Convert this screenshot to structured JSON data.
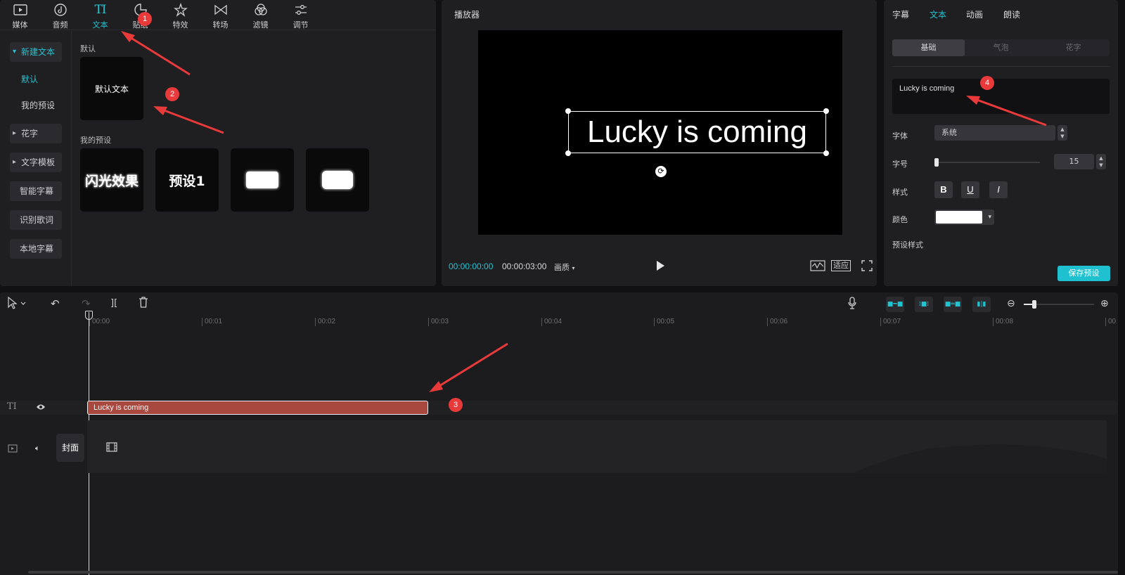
{
  "categories": [
    {
      "label": "媒体",
      "icon": "media-icon"
    },
    {
      "label": "音频",
      "icon": "audio-icon"
    },
    {
      "label": "文本",
      "icon": "text-icon"
    },
    {
      "label": "贴纸",
      "icon": "sticker-icon"
    },
    {
      "label": "特效",
      "icon": "effects-icon"
    },
    {
      "label": "转场",
      "icon": "transition-icon"
    },
    {
      "label": "滤镜",
      "icon": "filter-icon"
    },
    {
      "label": "调节",
      "icon": "adjust-icon"
    }
  ],
  "subnav": {
    "new_text": "新建文本",
    "default": "默认",
    "my_presets": "我的预设",
    "fancy_text": "花字",
    "text_template": "文字模板",
    "smart_subtitles": "智能字幕",
    "recognize_lyrics": "识别歌词",
    "local_subtitles": "本地字幕"
  },
  "library": {
    "default_section": "默认",
    "default_card": "默认文本",
    "presets_section": "我的预设",
    "preset_cards": [
      "闪光效果",
      "预设1",
      "",
      ""
    ]
  },
  "player": {
    "title": "播放器",
    "preview_text": "Lucky is coming",
    "current_time": "00:00:00:00",
    "total_time": "00:00:03:00",
    "quality": "画质",
    "fit": "适应"
  },
  "props": {
    "tabs": [
      "字幕",
      "文本",
      "动画",
      "朗读"
    ],
    "segments": [
      "基础",
      "气泡",
      "花字"
    ],
    "text_value": "Lucky is coming",
    "font_label": "字体",
    "font_value": "系统",
    "size_label": "字号",
    "size_value": "15",
    "size_level": 0,
    "style_label": "样式",
    "style_buttons": [
      "B",
      "U",
      "I"
    ],
    "color_label": "颜色",
    "color_value": "#ffffff",
    "preset_style_label": "预设样式",
    "save_preset": "保存预设"
  },
  "timeline": {
    "ticks": [
      "00:00",
      "00:01",
      "00:02",
      "00:03",
      "00:04",
      "00:05",
      "00:06",
      "00:07",
      "00:08",
      "00"
    ],
    "text_clip_label": "Lucky is coming",
    "cover_label": "封面"
  },
  "annotations": [
    "1",
    "2",
    "3",
    "4"
  ],
  "accent_color": "#22c3d1",
  "annotation_color": "#e83a3a"
}
